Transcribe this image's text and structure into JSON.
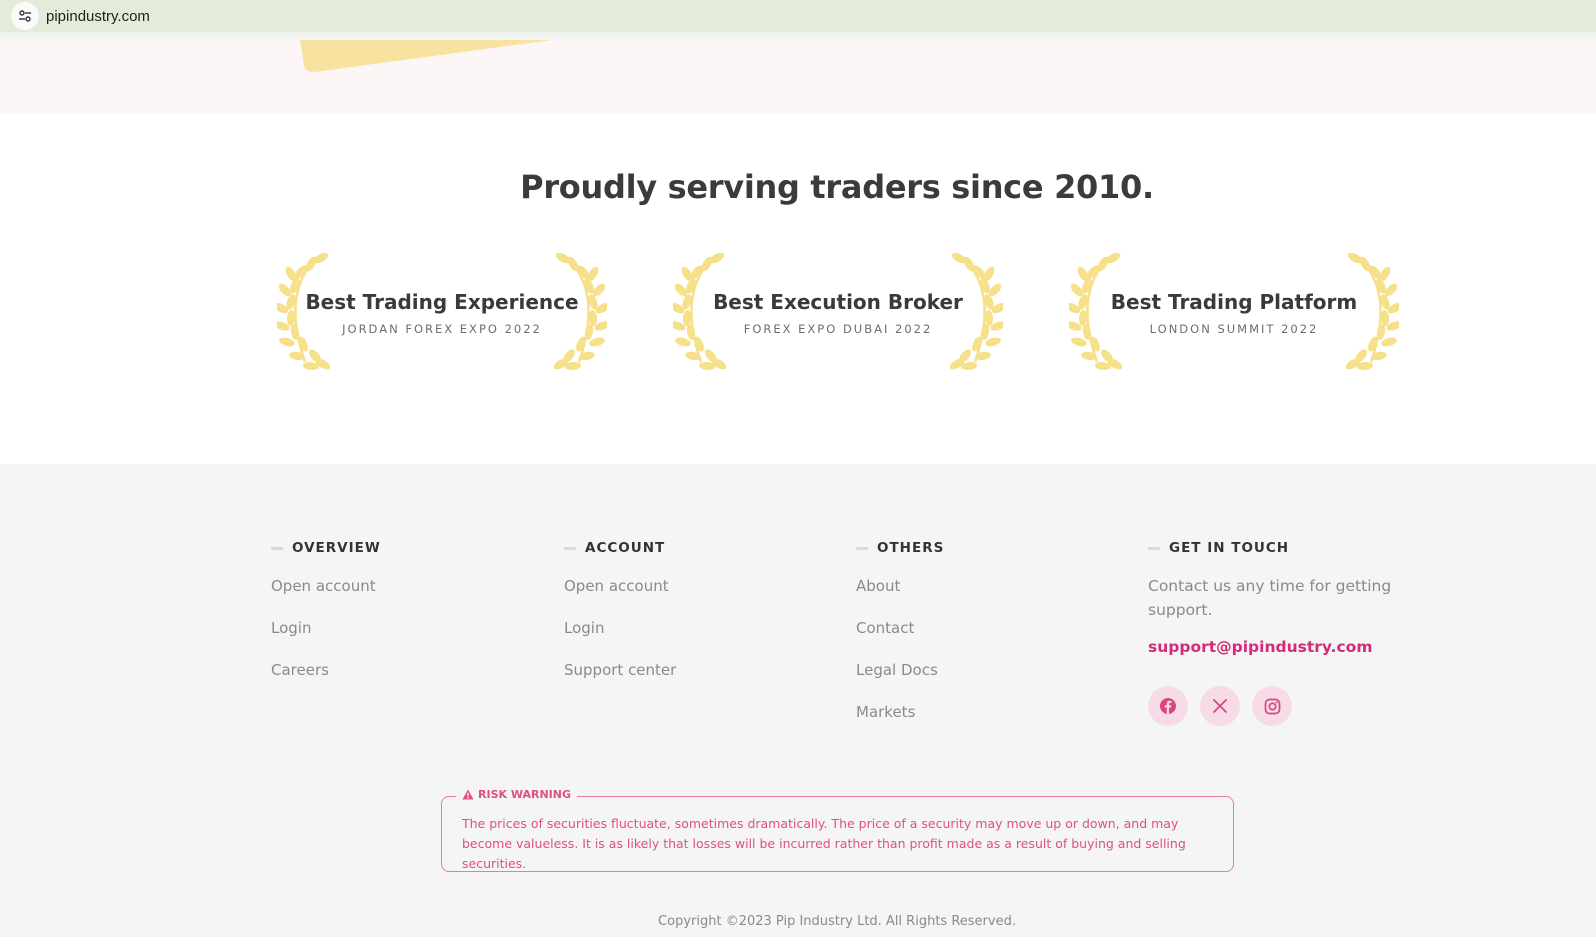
{
  "browser": {
    "url": "pipindustry.com",
    "site_info_icon": "tune-icon"
  },
  "awards": {
    "heading": "Proudly serving traders since 2010.",
    "items": [
      {
        "title": "Best Trading Experience",
        "subtitle": "JORDAN FOREX EXPO 2022"
      },
      {
        "title": "Best Execution Broker",
        "subtitle": "FOREX EXPO DUBAI 2022"
      },
      {
        "title": "Best Trading Platform",
        "subtitle": "LONDON SUMMIT 2022"
      }
    ]
  },
  "footer": {
    "overview": {
      "heading": "OVERVIEW",
      "links": [
        "Open account",
        "Login",
        "Careers"
      ]
    },
    "account": {
      "heading": "ACCOUNT",
      "links": [
        "Open account",
        "Login",
        "Support center"
      ]
    },
    "others": {
      "heading": "OTHERS",
      "links": [
        "About",
        "Contact",
        "Legal Docs",
        "Markets"
      ]
    },
    "contact": {
      "heading": "GET IN TOUCH",
      "text": "Contact us any time for getting support.",
      "email": "support@pipindustry.com",
      "socials": [
        "facebook-icon",
        "x-icon",
        "instagram-icon"
      ]
    },
    "risk": {
      "label": "RISK WARNING",
      "text": "The prices of securities fluctuate, sometimes dramatically. The price of a security may move up or down, and may become valueless. It is as likely that losses will be incurred rather than profit made as a result of buying and selling securities."
    },
    "copyright": "Copyright ©2023 Pip Industry Ltd. All Rights Reserved."
  },
  "colors": {
    "accent": "#d42a78",
    "risk": "#e0507f",
    "laurel": "#f6e08a",
    "social_bg": "#f7dbe6"
  }
}
